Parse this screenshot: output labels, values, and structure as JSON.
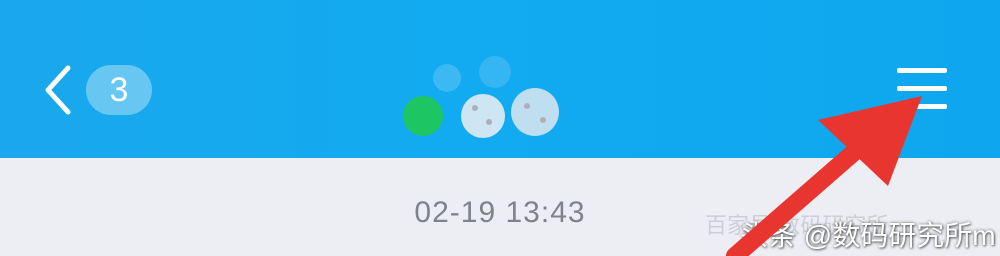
{
  "header": {
    "background_color": "#12aaf0",
    "back_button": {
      "icon": "chevron-left-icon"
    },
    "unread_badge": "3",
    "group_avatar": {
      "icon": "group-avatar-icon"
    },
    "menu_button": {
      "icon": "hamburger-menu-icon"
    }
  },
  "chat": {
    "timestamp": "02-19 13:43"
  },
  "overlay": {
    "annotation_arrow": {
      "icon": "red-arrow-icon",
      "color": "#e8352f"
    },
    "watermark_faint": "百家号·数码研究所",
    "watermark": "头条 @数码研究所m"
  }
}
